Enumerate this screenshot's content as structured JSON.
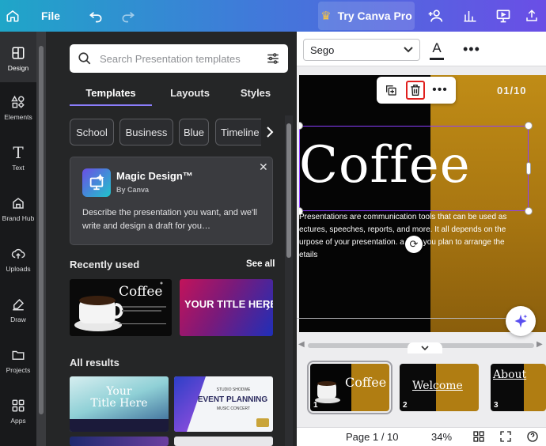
{
  "topbar": {
    "file_label": "File",
    "try_label": "Try Canva Pro",
    "icons": [
      "home-icon",
      "undo-icon",
      "redo-icon",
      "crown-icon",
      "people-icon",
      "analytics-icon",
      "present-icon",
      "share-icon"
    ]
  },
  "rail": {
    "items": [
      {
        "label": "Design",
        "icon": "design-icon"
      },
      {
        "label": "Elements",
        "icon": "elements-icon"
      },
      {
        "label": "Text",
        "icon": "text-icon"
      },
      {
        "label": "Brand Hub",
        "icon": "brand-hub-icon"
      },
      {
        "label": "Uploads",
        "icon": "uploads-icon"
      },
      {
        "label": "Draw",
        "icon": "draw-icon"
      },
      {
        "label": "Projects",
        "icon": "projects-icon"
      },
      {
        "label": "Apps",
        "icon": "apps-icon"
      }
    ]
  },
  "panel": {
    "search_placeholder": "Search Presentation templates",
    "tabs": [
      "Templates",
      "Layouts",
      "Styles"
    ],
    "chips": [
      "School",
      "Business",
      "Blue",
      "Timeline"
    ],
    "magic": {
      "title": "Magic Design™",
      "subtitle": "By Canva",
      "description": "Describe the presentation you want, and we'll write and design a draft for you…"
    },
    "recently_used": "Recently used",
    "see_all": "See all",
    "recent_items": [
      {
        "title": "Coffee"
      },
      {
        "title": "YOUR TITLE HERE"
      }
    ],
    "all_results": "All results",
    "results": [
      {
        "title": "Your\nTitle Here"
      },
      {
        "top": "STUDIO SHODWE",
        "title": "EVENT PLANNING",
        "sub": "MUSIC CONCERT"
      }
    ]
  },
  "canvas": {
    "font_name": "Sego",
    "color_label": "A",
    "slide_counter": "01/10",
    "slide_title": "Coffee",
    "slide_body": "Presentations are communication tools that can be used as ectures, speeches, reports, and more. It all depends on the urpose of your presentation. a how you plan to arrange the etails",
    "pages": [
      {
        "num": "1",
        "title": "Coffee"
      },
      {
        "num": "2",
        "title": "Welcome"
      },
      {
        "num": "3",
        "title": "About"
      }
    ],
    "footer": {
      "page_label": "Page 1 / 10",
      "zoom": "34%"
    }
  },
  "colors": {
    "accent_purple": "#8b3dff",
    "highlight_red": "#e0201e",
    "gold": "#b07d12"
  }
}
